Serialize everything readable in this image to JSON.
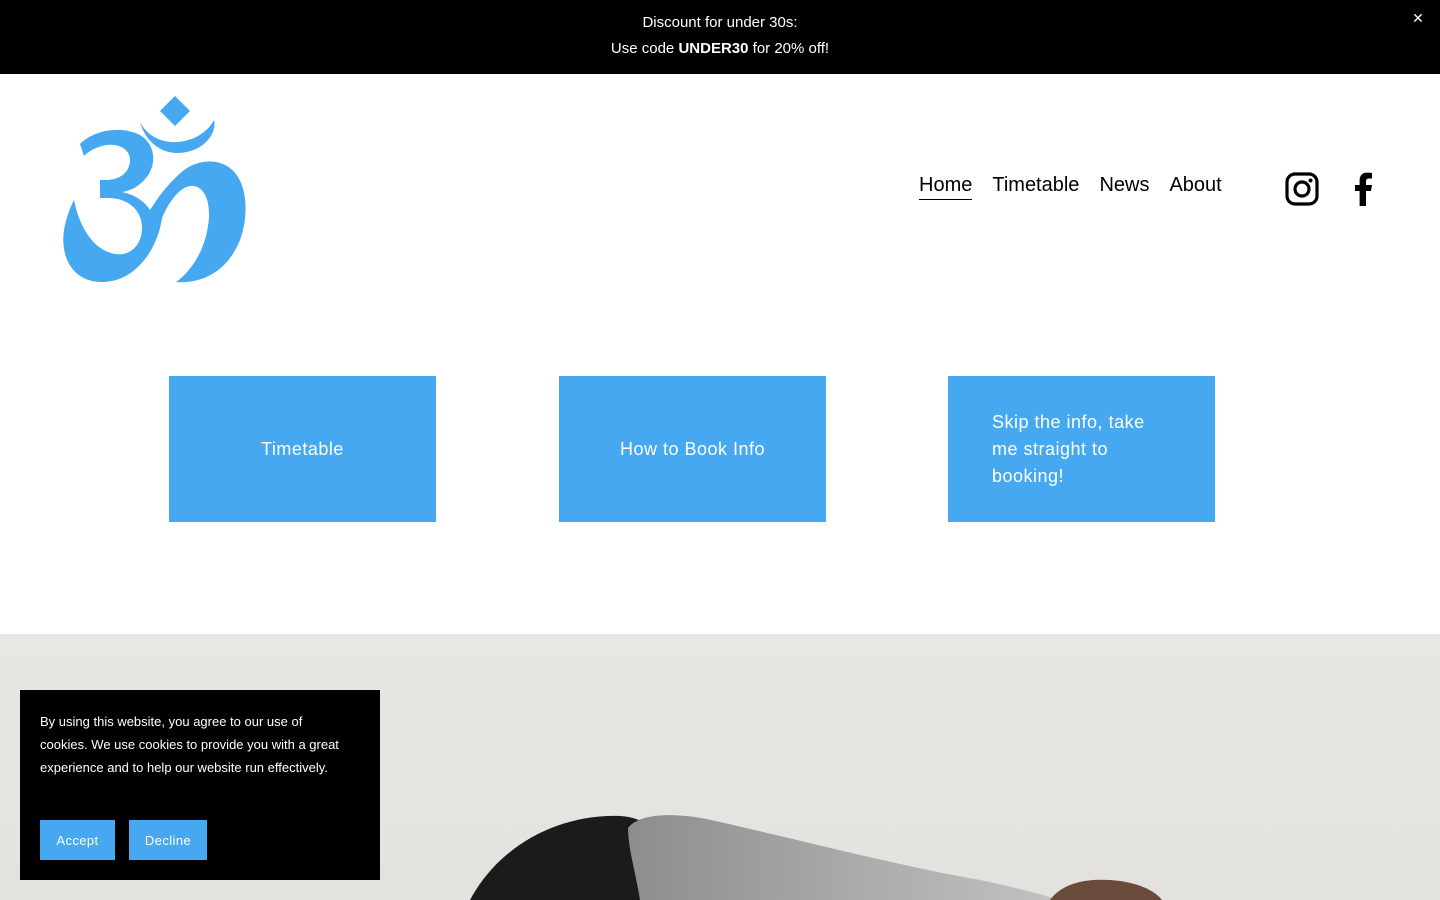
{
  "announcement": {
    "line1": "Discount for under 30s:",
    "line2_prefix": "Use code ",
    "line2_code": "UNDER30",
    "line2_suffix": " for 20% off!",
    "close_icon": "close-icon"
  },
  "header": {
    "logo_icon": "om-symbol-logo",
    "nav": [
      {
        "label": "Home",
        "active": true
      },
      {
        "label": "Timetable",
        "active": false
      },
      {
        "label": "News",
        "active": false
      },
      {
        "label": "About",
        "active": false
      }
    ],
    "social": [
      "instagram-icon",
      "facebook-icon"
    ]
  },
  "tiles": [
    {
      "label": "Timetable"
    },
    {
      "label": "How to Book Info"
    },
    {
      "label": "Skip the info, take me straight to booking!"
    }
  ],
  "cookie": {
    "message": "By using this website, you agree to our use of cookies. We use cookies to provide you with a great experience and to help our website run effectively.",
    "accept_label": "Accept",
    "decline_label": "Decline"
  },
  "colors": {
    "accent": "#45a8f0",
    "bar": "#000000",
    "text": "#000000"
  }
}
